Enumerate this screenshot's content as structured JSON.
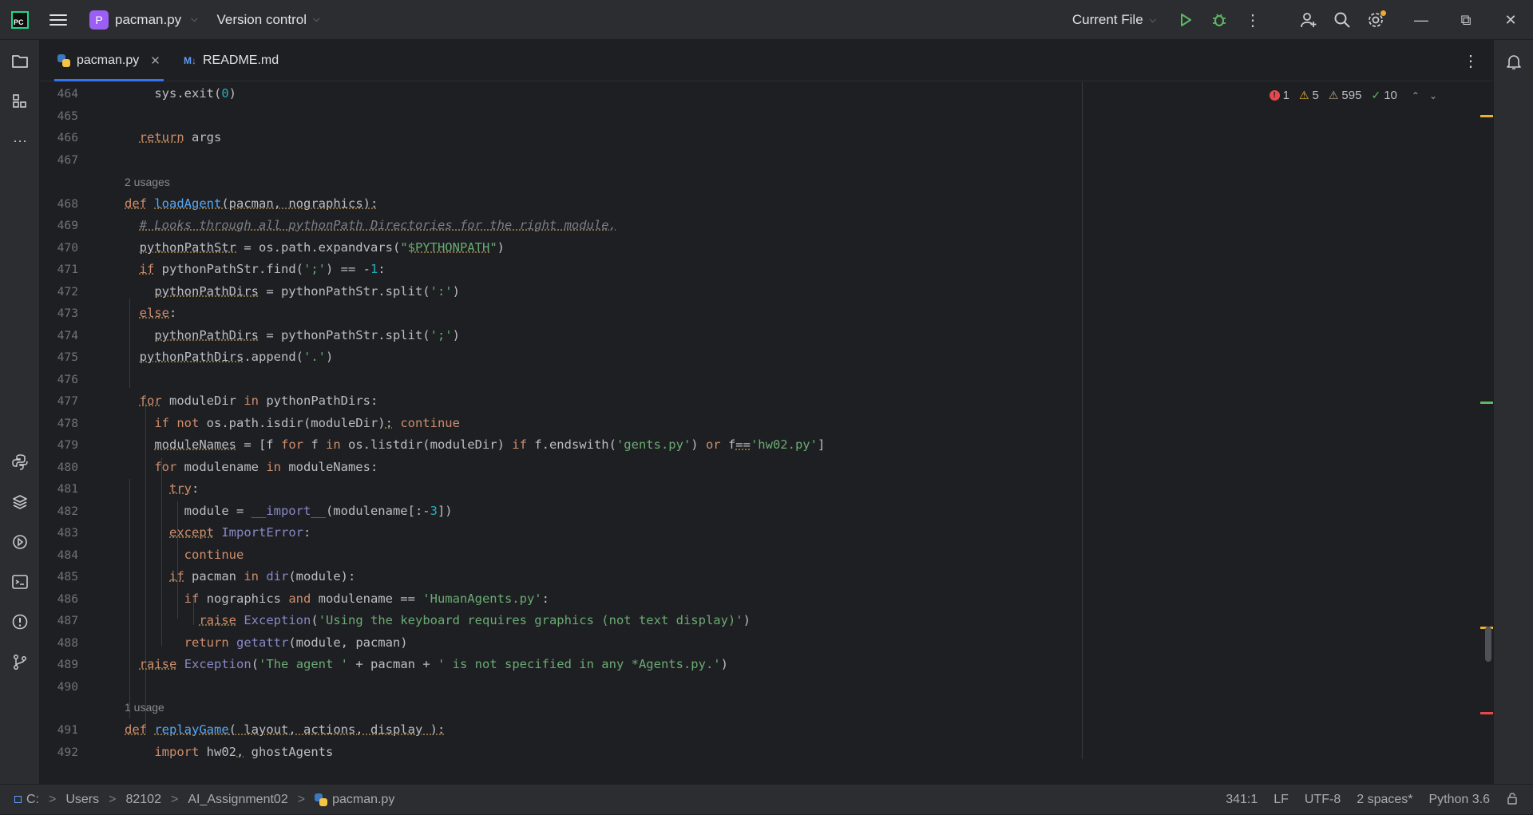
{
  "titlebar": {
    "logo_text": "PC",
    "project_badge": "P",
    "project_name": "pacman.py",
    "vcs_label": "Version control",
    "run_config": "Current File"
  },
  "tabs": [
    {
      "label": "pacman.py",
      "icon": "python-file-icon",
      "active": true
    },
    {
      "label": "README.md",
      "icon": "markdown-file-icon",
      "active": false
    }
  ],
  "inspections": {
    "errors": "1",
    "warnings": "5",
    "weak_warnings": "595",
    "typos": "10"
  },
  "editor": {
    "usages_1": "2 usages",
    "usages_2": "1 usage",
    "line_numbers": [
      "464",
      "465",
      "466",
      "467",
      "468",
      "469",
      "470",
      "471",
      "472",
      "473",
      "474",
      "475",
      "476",
      "477",
      "478",
      "479",
      "480",
      "481",
      "482",
      "483",
      "484",
      "485",
      "486",
      "487",
      "488",
      "489",
      "490",
      "491",
      "492"
    ]
  },
  "statusbar": {
    "path": [
      "C:",
      "Users",
      "82102",
      "AI_Assignment02",
      "pacman.py"
    ],
    "position": "341:1",
    "line_sep": "LF",
    "encoding": "UTF-8",
    "indent": "2 spaces*",
    "interpreter": "Python 3.6"
  },
  "colors": {
    "background": "#1e1f22",
    "panel": "#2b2d30",
    "accent": "#3574f0",
    "keyword": "#cf8e6d",
    "string": "#6aab73",
    "function": "#56a8f5"
  }
}
